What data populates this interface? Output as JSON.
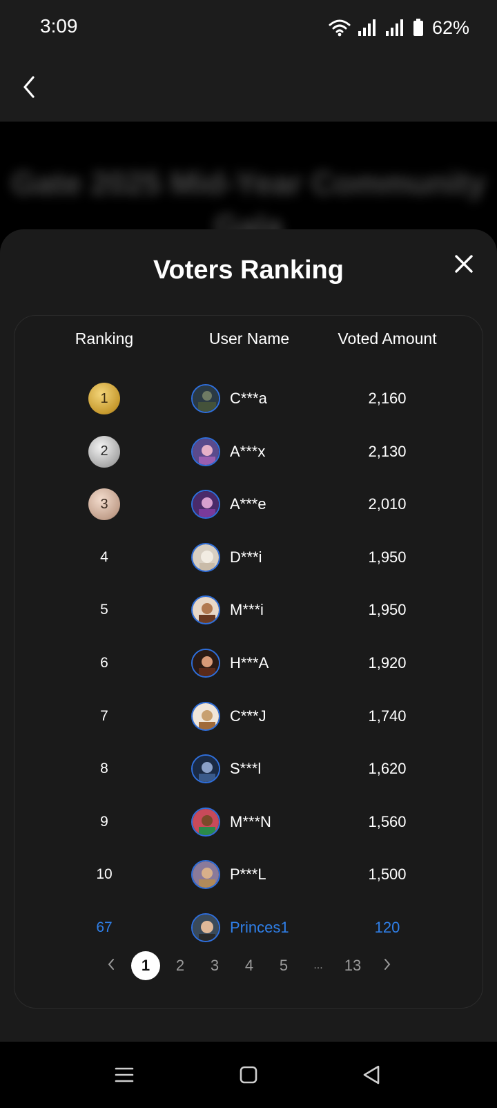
{
  "status_bar": {
    "time": "3:09",
    "battery": "62%"
  },
  "background_title": "Gate 2025 Mid-Year Community Gala",
  "modal": {
    "title": "Voters Ranking"
  },
  "table": {
    "headers": [
      "Ranking",
      "User Name",
      "Voted Amount"
    ],
    "rows": [
      {
        "rank": "1",
        "name": "C***a",
        "amount": "2,160"
      },
      {
        "rank": "2",
        "name": "A***x",
        "amount": "2,130"
      },
      {
        "rank": "3",
        "name": "A***e",
        "amount": "2,010"
      },
      {
        "rank": "4",
        "name": "D***i",
        "amount": "1,950"
      },
      {
        "rank": "5",
        "name": "M***i",
        "amount": "1,950"
      },
      {
        "rank": "6",
        "name": "H***A",
        "amount": "1,920"
      },
      {
        "rank": "7",
        "name": "C***J",
        "amount": "1,740"
      },
      {
        "rank": "8",
        "name": "S***l",
        "amount": "1,620"
      },
      {
        "rank": "9",
        "name": "M***N",
        "amount": "1,560"
      },
      {
        "rank": "10",
        "name": "P***L",
        "amount": "1,500"
      }
    ],
    "self_row": {
      "rank": "67",
      "name": "Princes1",
      "amount": "120"
    }
  },
  "pagination": {
    "pages": [
      "1",
      "2",
      "3",
      "4",
      "5"
    ],
    "ellipsis": "...",
    "last_page": "13",
    "current": "1"
  },
  "colors": {
    "accent": "#2f7fe8",
    "background": "#1b1b1b",
    "gold": "#c79a2e",
    "silver": "#a9a9a9",
    "bronze": "#c2a08c"
  },
  "icons": {
    "status": [
      "wifi-icon",
      "signal-icon",
      "signal-icon",
      "battery-icon"
    ],
    "header": "chevron-left-icon",
    "modal_close": "close-icon",
    "nav": [
      "menu-icon",
      "home-square-icon",
      "back-triangle-icon"
    ]
  }
}
